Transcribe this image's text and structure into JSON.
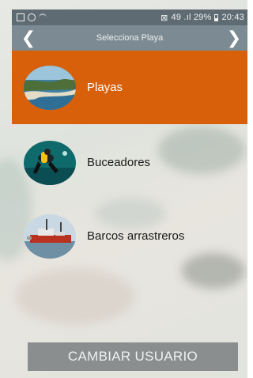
{
  "status_bar": {
    "left_icons": [
      "gallery-icon",
      "whatsapp-icon",
      "wifi-icon"
    ],
    "right_text": "49 .ıl 29%",
    "time": "20:43",
    "colors": {
      "background": "#5f6b73"
    }
  },
  "header": {
    "title": "Selecciona Playa",
    "back_icon": "chevron-left-icon",
    "forward_icon": "chevron-right-icon",
    "back_glyph": "❮",
    "forward_glyph": "❯",
    "colors": {
      "background": "#7c8b93"
    }
  },
  "list": {
    "items": [
      {
        "label": "Playas",
        "icon": "beach-thumbnail",
        "selected": true
      },
      {
        "label": "Buceadores",
        "icon": "diver-thumbnail",
        "selected": false
      },
      {
        "label": "Barcos arrastreros",
        "icon": "trawler-thumbnail",
        "selected": false
      }
    ],
    "colors": {
      "selected_background": "#d8600a"
    }
  },
  "footer": {
    "change_user_label": "CAMBIAR USUARIO",
    "colors": {
      "button_background": "#8a8e8f"
    }
  }
}
